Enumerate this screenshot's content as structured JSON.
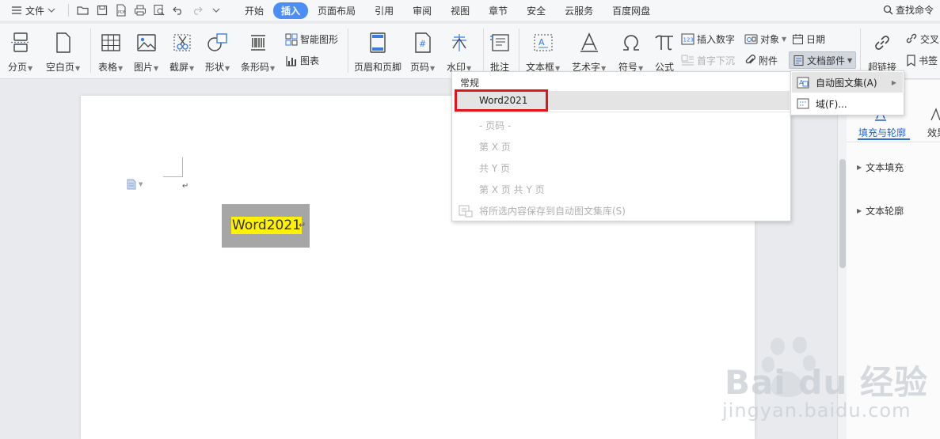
{
  "menubar": {
    "file_label": "文件",
    "tabs": [
      "开始",
      "插入",
      "页面布局",
      "引用",
      "审阅",
      "视图",
      "章节",
      "安全",
      "云服务",
      "百度网盘"
    ],
    "active_tab": "插入",
    "search_label": "查找命令"
  },
  "ribbon": {
    "page_break": "分页",
    "blank_page": "空白页",
    "table": "表格",
    "picture": "图片",
    "screenshot": "截屏",
    "shape": "形状",
    "barcode": "条形码",
    "smart_shape": "智能图形",
    "chart": "图表",
    "header_footer": "页眉和页脚",
    "page_number": "页码",
    "watermark": "水印",
    "comment": "批注",
    "textbox": "文本框",
    "wordart": "艺术字",
    "symbol": "符号",
    "formula": "公式",
    "insert_number": "插入数字",
    "object": "对象",
    "date": "日期",
    "drop_cap": "首字下沉",
    "attachment": "附件",
    "doc_parts": "文档部件",
    "hyperlink": "超链接",
    "cross_ref": "交叉",
    "bookmark": "书签"
  },
  "document": {
    "selected_text": "Word2021"
  },
  "right_panel": {
    "tab_fill": "填充与轮廓",
    "tab_effect": "效果",
    "section_fill": "文本填充",
    "section_outline": "文本轮廓"
  },
  "dropdown": {
    "heading": "常规",
    "selected_item": "Word2021",
    "disabled_items": [
      "- 页码 -",
      "第 X 页",
      "共 Y 页",
      "第 X 页 共 Y 页"
    ],
    "save_item": "将所选内容保存到自动图文集库(S)"
  },
  "submenu": {
    "autotext": "自动图文集(A)",
    "field": "域(F)..."
  },
  "watermark": {
    "brand": "Bai du 经验",
    "url": "jingyan.baidu.com"
  }
}
